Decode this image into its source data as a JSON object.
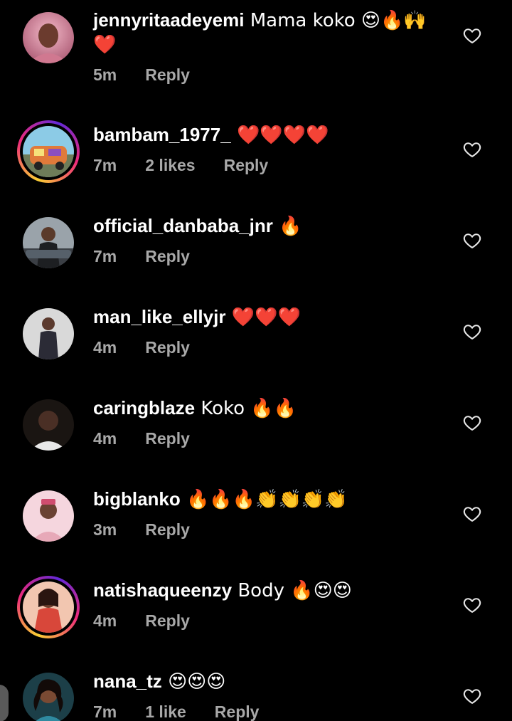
{
  "comments": [
    {
      "username": "jennyritaadeyemi",
      "text": " Mama koko 😍🔥🙌 ❤️",
      "time": "5m",
      "likes": "",
      "reply": "Reply",
      "story_ring": false,
      "avatar_colors": [
        "#b1617a",
        "#f3b9c8"
      ]
    },
    {
      "username": "bambam_1977_",
      "text": " ❤️❤️❤️❤️",
      "time": "7m",
      "likes": "2 likes",
      "reply": "Reply",
      "story_ring": true,
      "avatar_colors": [
        "#e07a3a",
        "#63b7d8"
      ]
    },
    {
      "username": "official_danbaba_jnr",
      "text": " 🔥",
      "time": "7m",
      "likes": "",
      "reply": "Reply",
      "story_ring": false,
      "avatar_colors": [
        "#3b3f45",
        "#9aa3aa"
      ]
    },
    {
      "username": "man_like_ellyjr",
      "text": " ❤️❤️❤️",
      "time": "4m",
      "likes": "",
      "reply": "Reply",
      "story_ring": false,
      "avatar_colors": [
        "#5b3a2e",
        "#d9d9d9"
      ]
    },
    {
      "username": "caringblaze",
      "text": " Koko 🔥🔥",
      "time": "4m",
      "likes": "",
      "reply": "Reply",
      "story_ring": false,
      "avatar_colors": [
        "#2a1d18",
        "#cfcfcf"
      ]
    },
    {
      "username": "bigblanko",
      "text": " 🔥🔥🔥👏👏👏👏",
      "time": "3m",
      "likes": "",
      "reply": "Reply",
      "story_ring": false,
      "avatar_colors": [
        "#e7a9b8",
        "#f5d6de"
      ]
    },
    {
      "username": "natishaqueenzy",
      "text": " Body 🔥😍😍",
      "time": "4m",
      "likes": "",
      "reply": "Reply",
      "story_ring": true,
      "avatar_colors": [
        "#d8473a",
        "#f2a07a"
      ]
    },
    {
      "username": "nana_tz",
      "text": " 😍😍😍",
      "time": "7m",
      "likes": "1 like",
      "reply": "Reply",
      "story_ring": false,
      "avatar_colors": [
        "#1c3f48",
        "#2f8aa0"
      ]
    }
  ],
  "icons": {
    "like": "heart-outline-icon"
  },
  "colors": {
    "background": "#000000",
    "text": "#ffffff",
    "meta": "#a8a8a8"
  }
}
